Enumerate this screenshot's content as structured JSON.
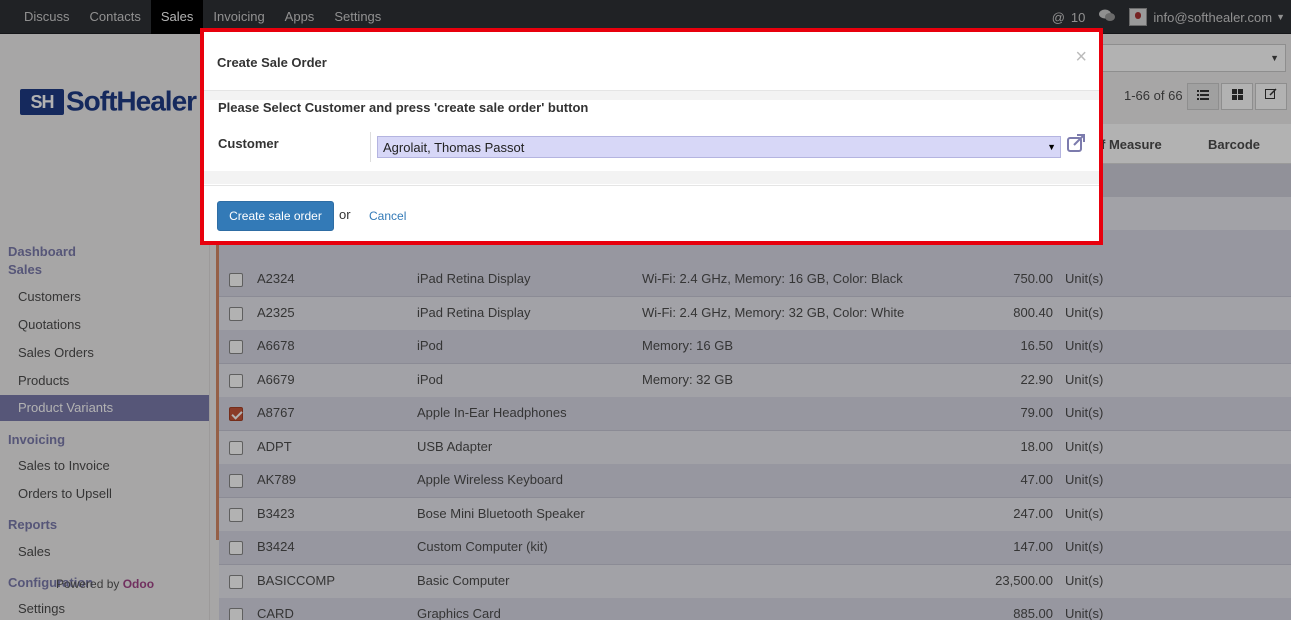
{
  "topbar": {
    "menu": [
      "Discuss",
      "Contacts",
      "Sales",
      "Invoicing",
      "Apps",
      "Settings"
    ],
    "active_menu": "Sales",
    "mention_icon": "@",
    "notification_count": "10",
    "chat_icon": "chat-bubbles-icon",
    "user_email": "info@softhealer.com"
  },
  "logo": {
    "mark": "SH",
    "text": "SoftHealer"
  },
  "sidebar": {
    "dashboard": "Dashboard",
    "sales_title": "Sales",
    "sales_items": [
      "Customers",
      "Quotations",
      "Sales Orders",
      "Products",
      "Product Variants"
    ],
    "active_item": "Product Variants",
    "invoicing_title": "Invoicing",
    "invoicing_items": [
      "Sales to Invoice",
      "Orders to Upsell"
    ],
    "reports_title": "Reports",
    "reports_items": [
      "Sales"
    ],
    "configuration_title": "Configuration",
    "configuration_items": [
      "Settings"
    ],
    "powered_prefix": "Powered by",
    "powered_brand": "Odoo"
  },
  "control_panel": {
    "pager": "1-66 of 66",
    "views": [
      "list-view-icon",
      "kanban-view-icon",
      "edit-view-icon"
    ]
  },
  "table": {
    "partial_headers": [
      "f Measure",
      "Barcode"
    ],
    "rows": [
      {
        "ref": "A2324",
        "name": "iPad Retina Display",
        "attr": "Wi-Fi: 2.4 GHz, Memory: 16 GB, Color: Black",
        "price": "750.00",
        "uom": "Unit(s)",
        "checked": false
      },
      {
        "ref": "A2325",
        "name": "iPad Retina Display",
        "attr": "Wi-Fi: 2.4 GHz, Memory: 32 GB, Color: White",
        "price": "800.40",
        "uom": "Unit(s)",
        "checked": false
      },
      {
        "ref": "A6678",
        "name": "iPod",
        "attr": "Memory: 16 GB",
        "price": "16.50",
        "uom": "Unit(s)",
        "checked": false
      },
      {
        "ref": "A6679",
        "name": "iPod",
        "attr": "Memory: 32 GB",
        "price": "22.90",
        "uom": "Unit(s)",
        "checked": false
      },
      {
        "ref": "A8767",
        "name": "Apple In-Ear Headphones",
        "attr": "",
        "price": "79.00",
        "uom": "Unit(s)",
        "checked": true
      },
      {
        "ref": "ADPT",
        "name": "USB Adapter",
        "attr": "",
        "price": "18.00",
        "uom": "Unit(s)",
        "checked": false
      },
      {
        "ref": "AK789",
        "name": "Apple Wireless Keyboard",
        "attr": "",
        "price": "47.00",
        "uom": "Unit(s)",
        "checked": false
      },
      {
        "ref": "B3423",
        "name": "Bose Mini Bluetooth Speaker",
        "attr": "",
        "price": "247.00",
        "uom": "Unit(s)",
        "checked": false
      },
      {
        "ref": "B3424",
        "name": "Custom Computer (kit)",
        "attr": "",
        "price": "147.00",
        "uom": "Unit(s)",
        "checked": false
      },
      {
        "ref": "BASICCOMP",
        "name": "Basic Computer",
        "attr": "",
        "price": "23,500.00",
        "uom": "Unit(s)",
        "checked": false
      },
      {
        "ref": "CARD",
        "name": "Graphics Card",
        "attr": "",
        "price": "885.00",
        "uom": "Unit(s)",
        "checked": false
      }
    ]
  },
  "modal": {
    "title": "Create Sale Order",
    "close": "×",
    "instruction": "Please Select Customer and press 'create sale order' button",
    "customer_label": "Customer",
    "customer_value": "Agrolait, Thomas Passot",
    "external_link_icon": "external-link-icon",
    "primary_button": "Create sale order",
    "or_text": "or",
    "cancel_link": "Cancel",
    "highlight_color": "#e8000d"
  }
}
